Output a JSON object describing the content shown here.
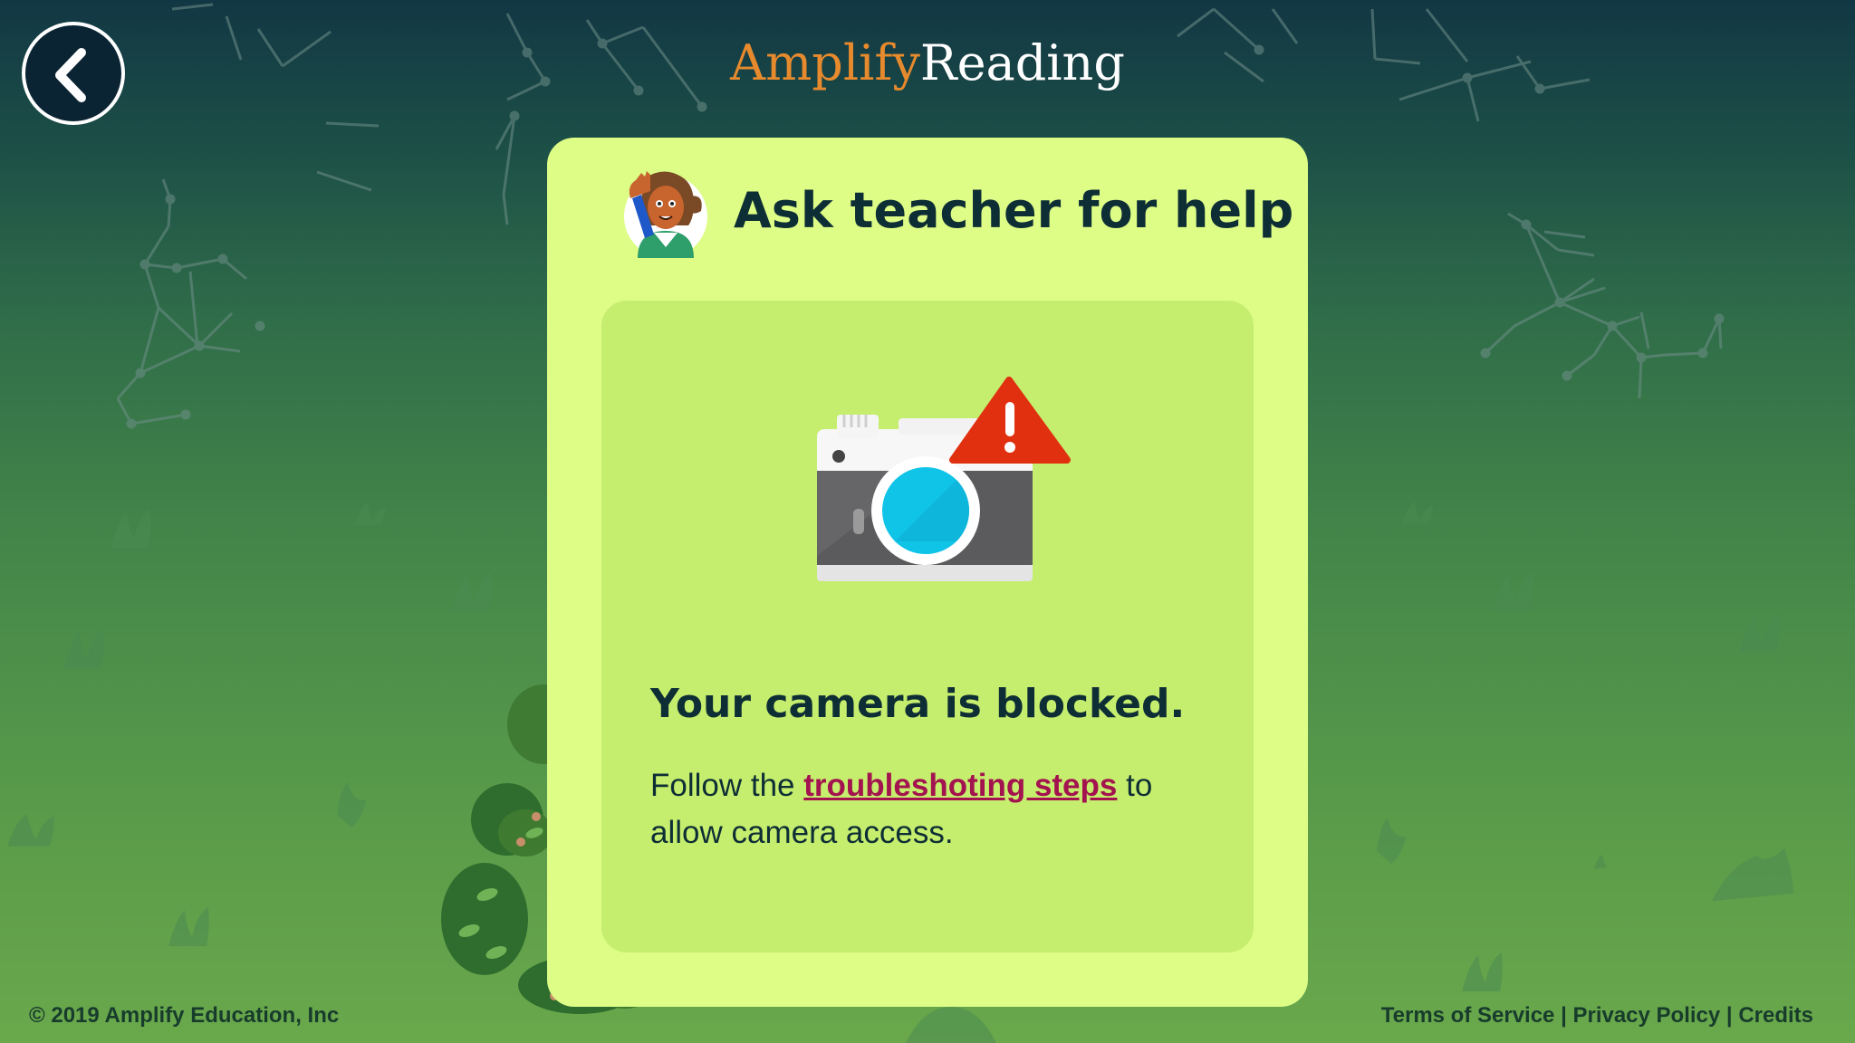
{
  "colors": {
    "accent_brand": "#e78a2d",
    "card_bg": "#ddfd87",
    "panel_bg": "#c6ee6e",
    "heading_text": "#0e2e35",
    "link": "#a3134f",
    "warning": "#e0300f",
    "lens": "#10c4e8"
  },
  "header": {
    "back_icon": "chevron-left-icon",
    "logo_part_1": "Amplify",
    "logo_part_2": "Reading"
  },
  "card": {
    "title": "Ask teacher for help",
    "avatar_icon": "teacher-raising-hand-avatar",
    "camera_icon": "blocked-camera-icon",
    "heading": "Your camera is blocked.",
    "body_prefix": "Follow the ",
    "link_text": "troubleshoting steps",
    "body_suffix": " to allow camera access."
  },
  "footer": {
    "copyright": "© 2019 Amplify Education, Inc",
    "links": [
      "Terms of Service",
      "Privacy Policy",
      "Credits"
    ],
    "separator": " | "
  }
}
